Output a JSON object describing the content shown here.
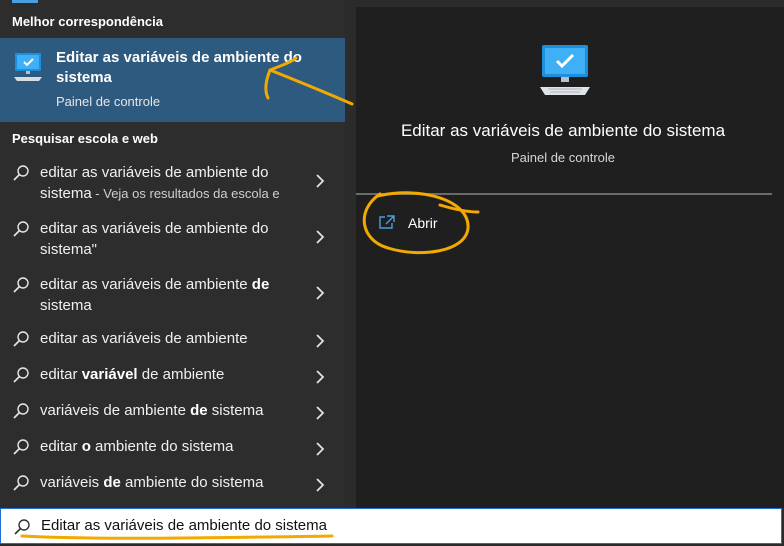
{
  "best_match": {
    "header": "Melhor correspondência",
    "title": "Editar as variáveis de ambiente do sistema",
    "subtitle": "Painel de controle"
  },
  "web_search": {
    "header": "Pesquisar escola e web",
    "items": [
      {
        "parts": [
          {
            "t": "editar as variáveis de ambiente do sistema",
            "b": false
          },
          {
            "t": " - Veja os resultados da escola e",
            "b": false,
            "sub": true
          }
        ]
      },
      {
        "parts": [
          {
            "t": "editar as variáveis de ambiente do sistema\"",
            "b": false
          }
        ]
      },
      {
        "parts": [
          {
            "t": "editar as variáveis de ambiente ",
            "b": false
          },
          {
            "t": "de",
            "b": true
          },
          {
            "t": " sistema",
            "b": false
          }
        ]
      },
      {
        "parts": [
          {
            "t": "editar as variáveis de ambiente",
            "b": false
          }
        ]
      },
      {
        "parts": [
          {
            "t": "editar ",
            "b": false
          },
          {
            "t": "variável",
            "b": true
          },
          {
            "t": " de ambiente",
            "b": false
          }
        ]
      },
      {
        "parts": [
          {
            "t": "variáveis de ambiente ",
            "b": false
          },
          {
            "t": "de",
            "b": true
          },
          {
            "t": " sistema",
            "b": false
          }
        ]
      },
      {
        "parts": [
          {
            "t": "editar ",
            "b": false
          },
          {
            "t": "o",
            "b": true
          },
          {
            "t": " ambiente do sistema",
            "b": false
          }
        ]
      },
      {
        "parts": [
          {
            "t": "variáveis ",
            "b": false
          },
          {
            "t": "de",
            "b": true
          },
          {
            "t": " ambiente do sistema",
            "b": false
          }
        ]
      }
    ]
  },
  "preview": {
    "title": "Editar as variáveis de ambiente do sistema",
    "subtitle": "Painel de controle",
    "actions": [
      {
        "label": "Abrir",
        "icon": "open-external-icon"
      }
    ]
  },
  "search": {
    "query": "Editar as variáveis de ambiente do sistema",
    "icon": "search-icon"
  },
  "colors": {
    "accent": "#4a9fe0",
    "selected_bg": "#2f5a80",
    "annotation": "#f2a900"
  }
}
